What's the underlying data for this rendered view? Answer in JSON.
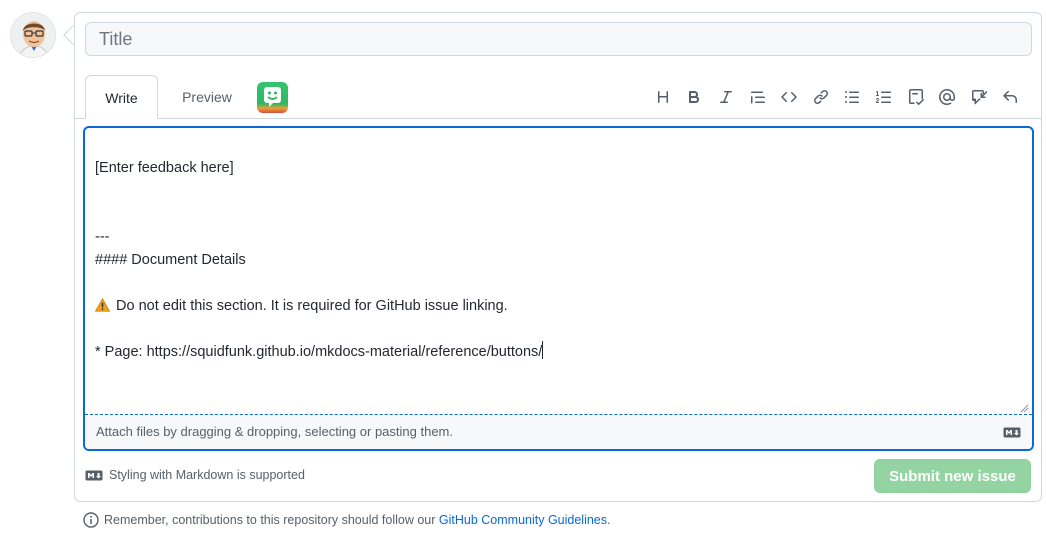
{
  "issue_form": {
    "title_placeholder": "Title",
    "title_value": ""
  },
  "tabs": [
    {
      "label": "Write",
      "active": true
    },
    {
      "label": "Preview",
      "active": false
    }
  ],
  "toolbar_icons": [
    "heading-icon",
    "bold-icon",
    "italic-icon",
    "quote-icon",
    "code-icon",
    "link-icon",
    "bulleted-list-icon",
    "numbered-list-icon",
    "task-list-icon",
    "mention-icon",
    "cross-reference-icon",
    "undo-icon"
  ],
  "editor": {
    "lines": [
      "",
      "[Enter feedback here]",
      "",
      "",
      "---",
      "#### Document Details",
      "",
      "Do not edit this section. It is required for GitHub issue linking.",
      "",
      "* Page: https://squidfunk.github.io/mkdocs-material/reference/buttons/"
    ],
    "warning_line_index": 7,
    "attach_hint": "Attach files by dragging & dropping, selecting or pasting them."
  },
  "footer": {
    "markdown_note": "Styling with Markdown is supported",
    "submit_label": "Submit new issue",
    "remember_prefix": "Remember, contributions to this repository should follow our ",
    "guidelines_link": "GitHub Community Guidelines",
    "remember_suffix": "."
  },
  "colors": {
    "accent": "#0969da",
    "submit_disabled": "#94d3a2",
    "border": "#d0d7de"
  }
}
